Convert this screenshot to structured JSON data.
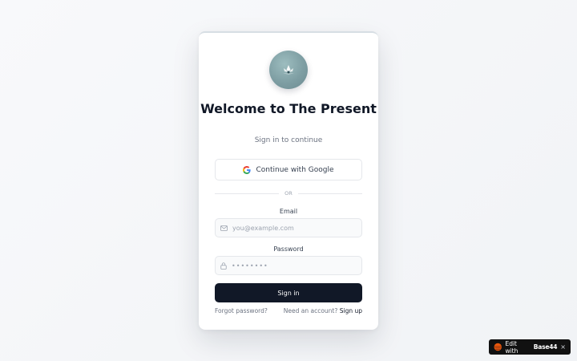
{
  "card": {
    "title": "Welcome to The Present",
    "subtitle": "Sign in to continue",
    "logo_icon": "lotus-icon",
    "google_button": {
      "label": "Continue with Google",
      "icon": "google-icon"
    },
    "divider_text": "OR",
    "email": {
      "label": "Email",
      "placeholder": "you@example.com",
      "icon": "mail-icon"
    },
    "password": {
      "label": "Password",
      "placeholder": "••••••••",
      "icon": "lock-icon"
    },
    "signin_button": "Sign in",
    "forgot_password": "Forgot password?",
    "need_account": "Need an account?",
    "sign_up": "Sign up"
  },
  "badge": {
    "edit_with": "Edit with",
    "brand": "Base44",
    "close": "×"
  },
  "colors": {
    "primary_button": "#111827",
    "logo_bg": "#7e9ea3",
    "badge_bg": "#111111",
    "badge_logo": "#ea580c"
  }
}
